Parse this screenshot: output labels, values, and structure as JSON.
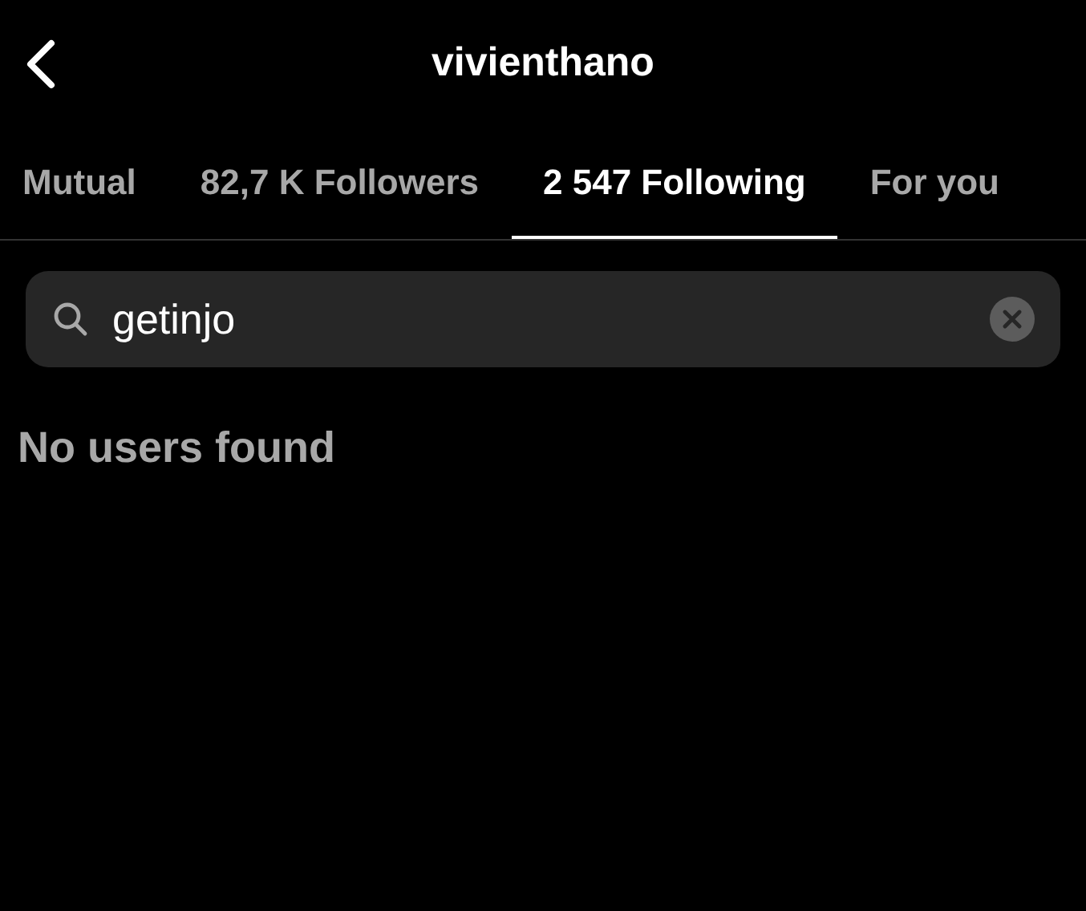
{
  "header": {
    "title": "vivienthano"
  },
  "tabs": [
    {
      "label": "Mutual",
      "selected": false
    },
    {
      "label": "82,7 K Followers",
      "selected": false
    },
    {
      "label": "2 547 Following",
      "selected": true
    },
    {
      "label": "For you",
      "selected": false
    }
  ],
  "search": {
    "value": "getinjo"
  },
  "empty_message": "No users found"
}
